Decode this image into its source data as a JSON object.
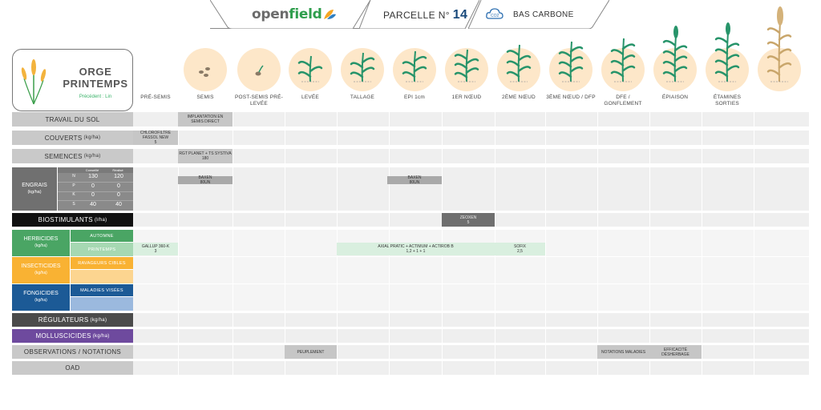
{
  "header": {
    "brand_open": "open",
    "brand_field": "field",
    "parcelle_label": "PARCELLE N°",
    "parcelle_num": "14",
    "carbone_label": "BAS CARBONE",
    "co2": "CO2"
  },
  "crop": {
    "name_line1": "ORGE",
    "name_line2": "PRINTEMPS",
    "precedent": "Précédent : Lin"
  },
  "stages": [
    {
      "label": "PRÉ-SEMIS",
      "icon": ""
    },
    {
      "label": "SEMIS",
      "icon": "seeds-icon"
    },
    {
      "label": "POST-SEMIS PRÉ-LEVÉE",
      "icon": "sprouting-seed-icon"
    },
    {
      "label": "LEVÉE",
      "icon": "seedling-icon"
    },
    {
      "label": "TALLAGE",
      "icon": "tillering-plant-icon"
    },
    {
      "label": "EPI 1cm",
      "icon": "ear-1cm-plant-icon"
    },
    {
      "label": "1ER NŒUD",
      "icon": "first-node-plant-icon"
    },
    {
      "label": "2ÈME NŒUD",
      "icon": "second-node-plant-icon"
    },
    {
      "label": "3ÈME NŒUD / DFP",
      "icon": "third-node-plant-icon"
    },
    {
      "label": "DFE / GONFLEMENT",
      "icon": "swelling-plant-icon"
    },
    {
      "label": "ÉPIAISON",
      "icon": "heading-plant-icon"
    },
    {
      "label": "ÉTAMINES SORTIES",
      "icon": "flowering-plant-icon"
    },
    {
      "label": "",
      "icon": "mature-plant-icon"
    }
  ],
  "rows": {
    "travail": "TRAVAIL DU SOL",
    "couverts": "COUVERTS",
    "couverts_unit": "(kg/ha)",
    "semences": "SEMENCES",
    "semences_unit": "(kg/ha)",
    "engrais": "ENGRAIS",
    "engrais_unit": "(kg/ha)",
    "biostimulants": "BIOSTIMULANTS",
    "biostimulants_unit": "(l/ha)",
    "herbicides": "HERBICIDES",
    "herbicides_unit": "(kg/ha)",
    "herb_automne": "AUTOMNE",
    "herb_printemps": "PRINTEMPS",
    "insecticides": "INSECTICIDES",
    "insecticides_unit": "(kg/ha)",
    "ravageurs": "RAVAGEURS CIBLES",
    "fongicides": "FONGICIDES",
    "fongicides_unit": "(kg/ha)",
    "maladies": "MALADIES VISÉES",
    "regulateurs": "RÉGULATEURS",
    "regulateurs_unit": "(kg/ha)",
    "molluscicides": "MOLLUSCICIDES",
    "molluscicides_unit": "(kg/ha)",
    "observations": "OBSERVATIONS / NOTATIONS",
    "oad": "OAD"
  },
  "engrais_table": {
    "headers": [
      "Conseillé",
      "Réalisé"
    ],
    "rows": [
      {
        "el": "N",
        "conseille": "130",
        "realise": "120"
      },
      {
        "el": "P",
        "conseille": "0",
        "realise": "0"
      },
      {
        "el": "K",
        "conseille": "0",
        "realise": "0"
      },
      {
        "el": "S",
        "conseille": "40",
        "realise": "40"
      }
    ]
  },
  "cells": {
    "travail_semis": "IMPLANTATION EN SEMIS DIRECT",
    "couverts_pre_1": "CHLOROFILTRE",
    "couverts_pre_2": "FASSOL NEW",
    "couverts_pre_3": "5",
    "semences_semis_1": "RGT PLANET + TS SYSTIVA",
    "semences_semis_2": "180",
    "engrais_semis_1": "BAXEN",
    "engrais_semis_2": "80UN",
    "engrais_epi_1": "BAXEN",
    "engrais_epi_2": "80UN",
    "bio_1": "ZEOXEN",
    "bio_2": "5",
    "herb_pre_1": "GALLUP 360-K",
    "herb_pre_2": "3",
    "herb_mid_1": "AXIAL PRATIC + ACTIMUM + ACTIROB B",
    "herb_mid_2": "1,2 + 1 + 1",
    "herb_sofix_1": "SOFIX",
    "herb_sofix_2": "2,5",
    "obs_peuplement": "PEUPLEMENT",
    "obs_maladies": "NOTATIONS MALADIES",
    "obs_efficacite": "EFFICACITÉ DÉSHERBAGE"
  },
  "colors": {
    "herbicides": "#4aa564",
    "insecticides": "#f9b233",
    "fongicides": "#1c5a96",
    "regulateurs": "#4b4b4b",
    "molluscicides": "#6e4a9e",
    "biostimulants": "#111111",
    "engrais": "#707070",
    "stage_circle": "#fde7c9"
  }
}
